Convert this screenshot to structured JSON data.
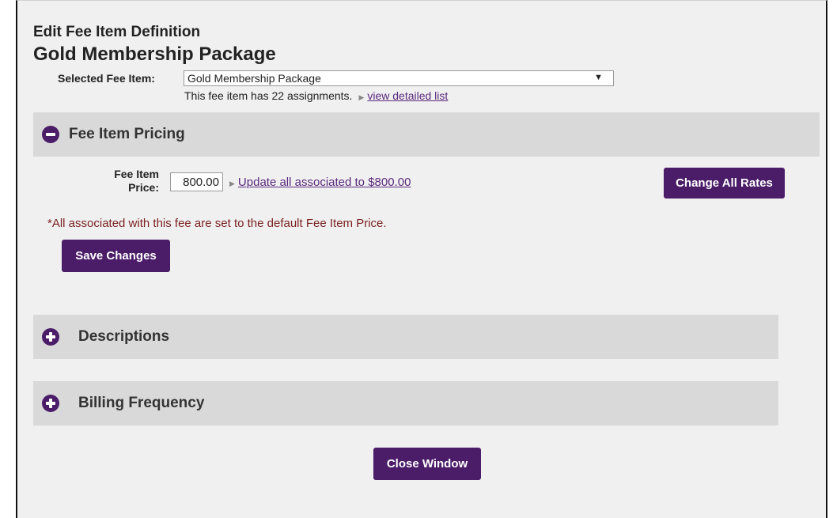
{
  "header": {
    "title": "Edit Fee Item Definition",
    "fee_item_name": "Gold Membership Package"
  },
  "selector": {
    "label": "Selected Fee Item:",
    "selected_value": "Gold Membership Package",
    "assignments_text": "This fee item has 22 assignments.",
    "view_list_link": "view detailed list"
  },
  "sections": {
    "pricing": {
      "title": "Fee Item Pricing",
      "expanded": true
    },
    "descriptions": {
      "title": "Descriptions",
      "expanded": false
    },
    "billing": {
      "title": "Billing Frequency",
      "expanded": false
    }
  },
  "pricing": {
    "price_label": "Fee Item Price:",
    "price_value": "800.00",
    "update_link": "Update all associated to $800.00",
    "change_rates_label": "Change All Rates",
    "note": "*All associated with this fee are set to the default Fee Item Price.",
    "save_label": "Save Changes"
  },
  "footer": {
    "close_label": "Close Window"
  },
  "colors": {
    "accent": "#4b1c68",
    "link": "#5a2a7d",
    "note": "#7a1f1f",
    "section_bar": "#d9d9d9",
    "panel_bg": "#f0f0f0"
  },
  "icons": {
    "collapse": "minus-circle-icon",
    "expand": "plus-circle-icon",
    "dropdown": "caret-down-icon",
    "link_pointer": "triangle-right-icon"
  }
}
